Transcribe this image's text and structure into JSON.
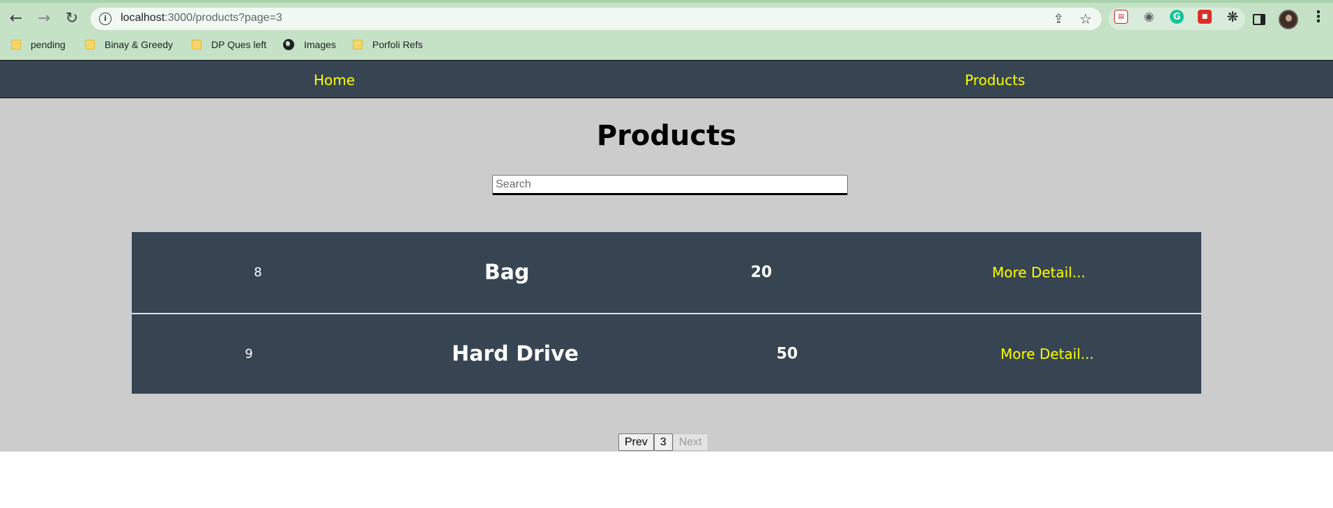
{
  "browser": {
    "url_host": "localhost",
    "url_rest": ":3000/products?page=3",
    "bookmarks": [
      {
        "label": "pending",
        "icon": "folder-icon"
      },
      {
        "label": "Binay & Greedy",
        "icon": "folder-icon"
      },
      {
        "label": "DP Ques left",
        "icon": "folder-icon"
      },
      {
        "label": "Images",
        "icon": "globe-icon"
      },
      {
        "label": "Porfoli Refs",
        "icon": "folder-icon"
      }
    ],
    "extensions": [
      "pdf-extension-icon",
      "camera-icon",
      "grammarly-icon",
      "pdf-tool-icon",
      "puzzle-icon"
    ]
  },
  "nav": {
    "home": "Home",
    "products": "Products"
  },
  "page_title": "Products",
  "search": {
    "placeholder": "Search",
    "value": ""
  },
  "products": [
    {
      "id": "8",
      "name": "Bag",
      "qty": "20",
      "link": "More Detail..."
    },
    {
      "id": "9",
      "name": "Hard Drive",
      "qty": "50",
      "link": "More Detail..."
    }
  ],
  "pagination": {
    "prev": "Prev",
    "current": "3",
    "next": "Next"
  },
  "colors": {
    "navbar": "#374553",
    "link": "#ffff00",
    "page_bg": "#cccccc",
    "chrome_bg": "#c5e2c7"
  }
}
